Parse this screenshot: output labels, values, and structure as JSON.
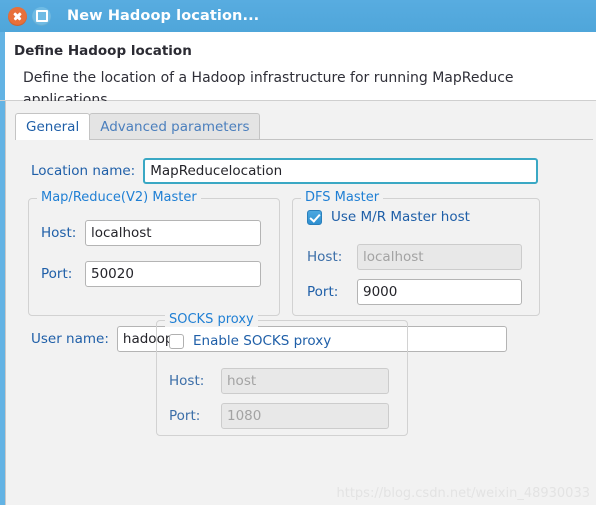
{
  "titlebar": {
    "title": "New Hadoop location...",
    "close_label": "Close",
    "maximize_label": "Maximize"
  },
  "header": {
    "title": "Define Hadoop location",
    "description": "Define the location of a Hadoop infrastructure for running MapReduce applications."
  },
  "tabs": [
    {
      "label": "General",
      "active": true
    },
    {
      "label": "Advanced parameters",
      "active": false
    }
  ],
  "form": {
    "location_name": {
      "label": "Location name:",
      "value": "MapReducelocation",
      "placeholder": ""
    },
    "user_name": {
      "label": "User name:",
      "value": "hadoop",
      "placeholder": ""
    },
    "mapreduce_master": {
      "legend": "Map/Reduce(V2) Master",
      "host_label": "Host:",
      "host_value": "localhost",
      "port_label": "Port:",
      "port_value": "50020"
    },
    "dfs_master": {
      "legend": "DFS Master",
      "use_mr_host_label": "Use M/R Master host",
      "use_mr_host_checked": "checked",
      "host_label": "Host:",
      "host_value": "localhost",
      "port_label": "Port:",
      "port_value": "9000"
    },
    "socks_proxy": {
      "legend": "SOCKS proxy",
      "enable_label": "Enable SOCKS proxy",
      "enable_checked": "unchecked",
      "host_label": "Host:",
      "host_value": "host",
      "port_label": "Port:",
      "port_value": "1080"
    }
  },
  "watermark": "https://blog.csdn.net/weixin_48930033",
  "colors": {
    "titlebar_blue": "#51a8da",
    "accent_left_border": "#63b3e4",
    "label_blue": "#1f5fa8",
    "legend_blue": "#1f7fd4",
    "panel_bg": "#f2f2f2",
    "focus_border": "#3aa8c4",
    "close_button": "#e8703a",
    "maximize_button": "#6fbbe4"
  }
}
